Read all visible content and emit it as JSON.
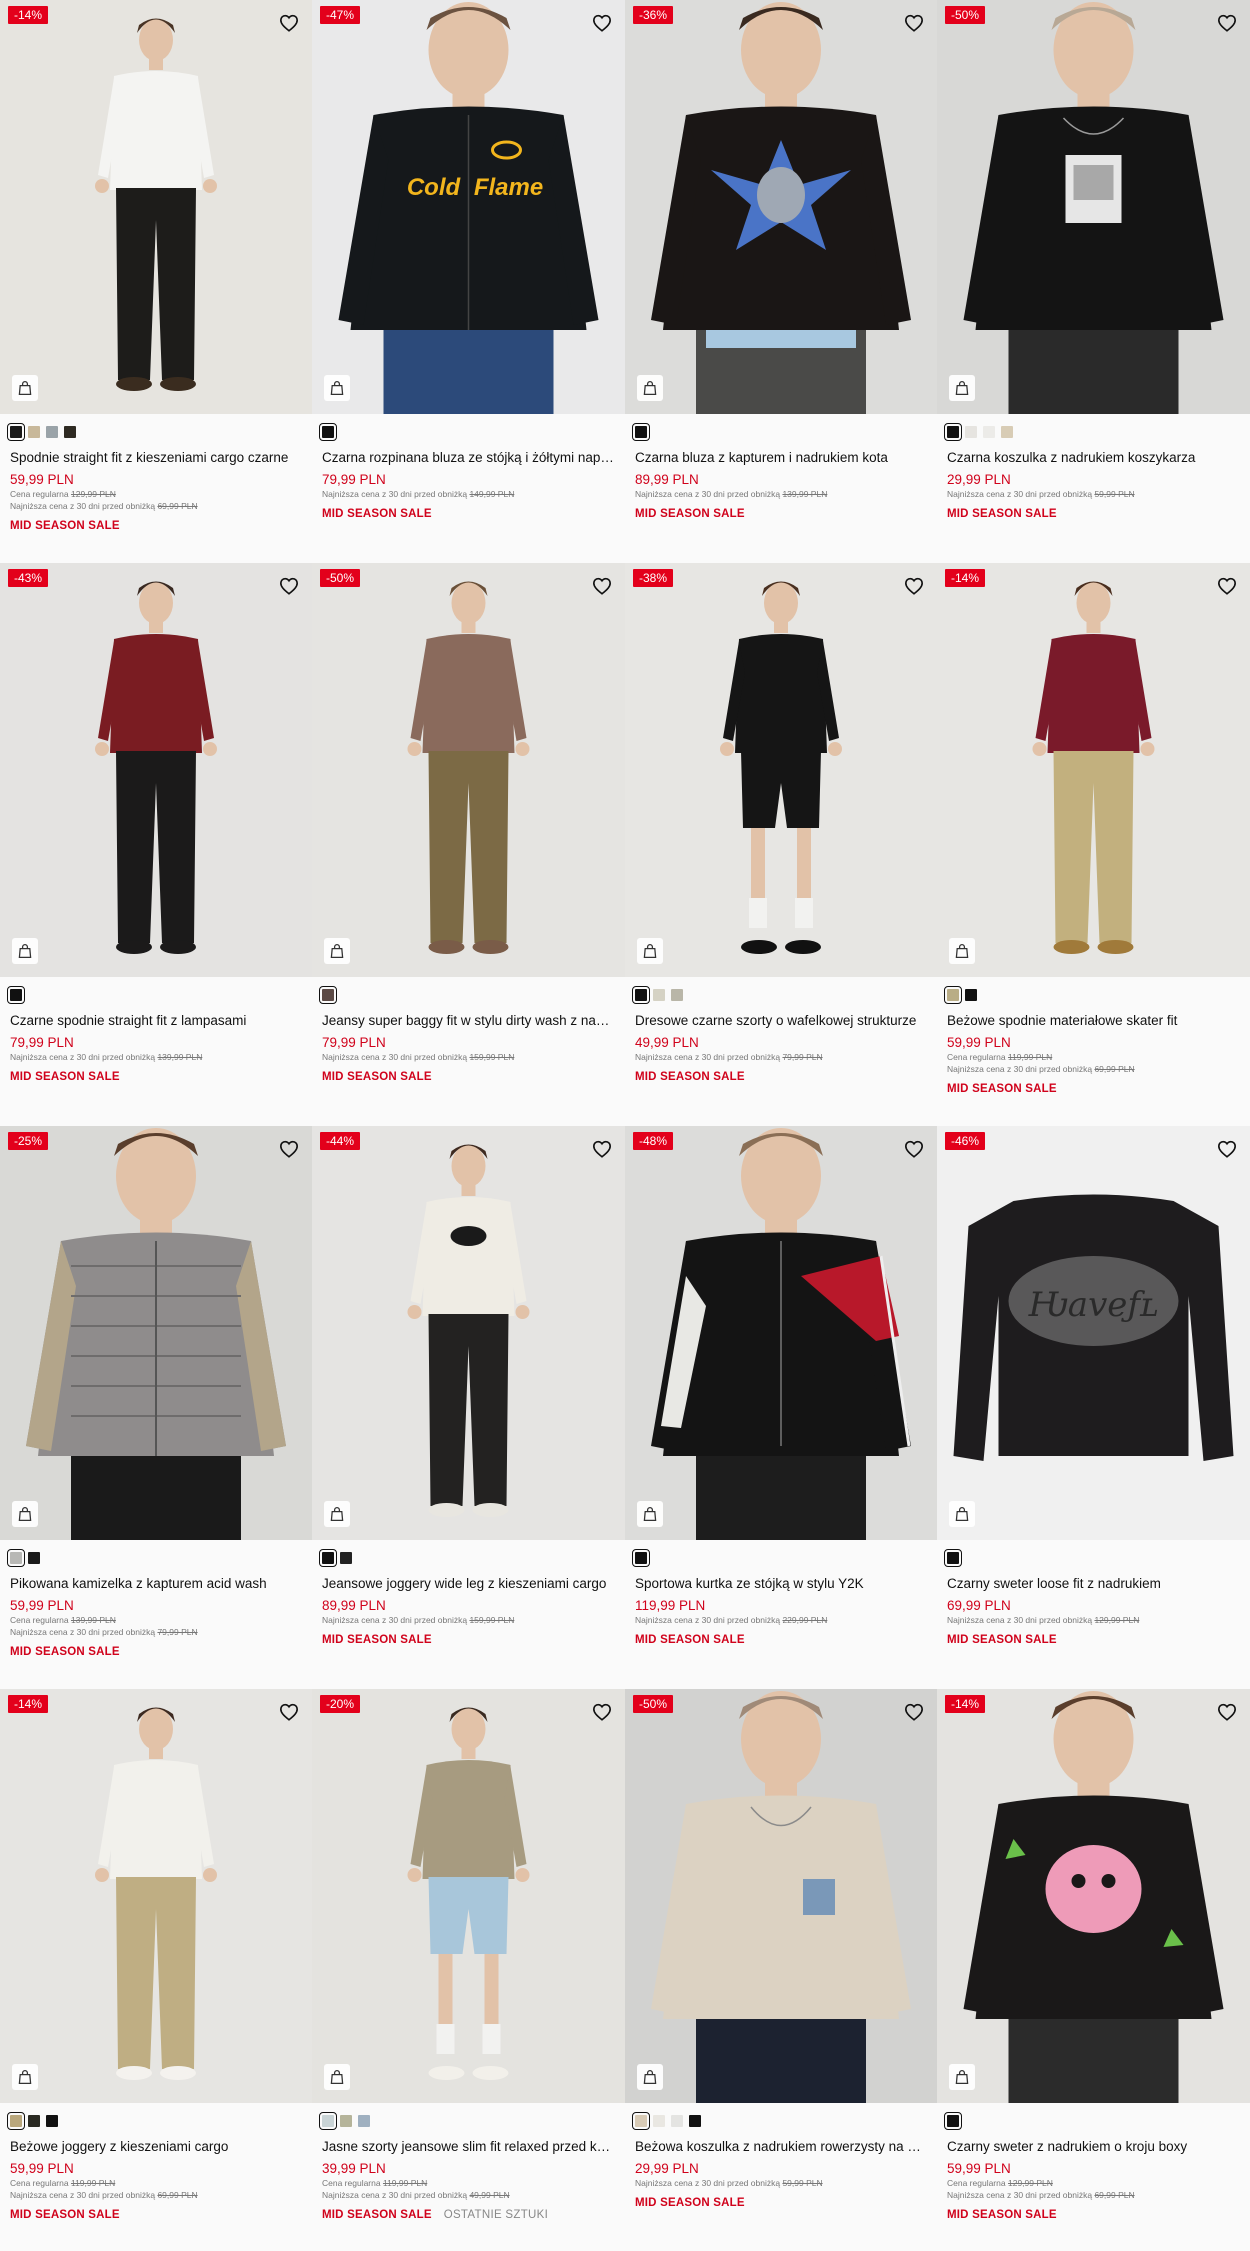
{
  "labels": {
    "regular": "Cena regularna",
    "lowest": "Najniższa cena z 30 dni przed obniżką",
    "currency": "PLN"
  },
  "products": [
    {
      "badge": "-14%",
      "name": "Spodnie straight fit z kieszeniami cargo czarne",
      "price": "59,99 PLN",
      "regular": "129,99 PLN",
      "lowest": "69,99 PLN",
      "sale": "MID SEASON SALE",
      "swatches": [
        "#1a1a1a",
        "#c8b89a",
        "#9aa3a8",
        "#2e2a22"
      ],
      "bg": "#e6e4df",
      "top": "#f4f4f2",
      "bottom": "#1d1c1a",
      "shoes": "#3a2c1f",
      "hair": "#4a3425",
      "pose": "standing",
      "print": ""
    },
    {
      "badge": "-47%",
      "name": "Czarna rozpinana bluza ze stójką i żółtymi napisami",
      "price": "79,99 PLN",
      "lowest": "149,99 PLN",
      "sale": "MID SEASON SALE",
      "swatches": [
        "#111111"
      ],
      "bg": "#e9e9ea",
      "top": "#15181b",
      "bottom": "#2c4a7a",
      "shoes": "#2c4a7a",
      "hair": "#6b5240",
      "pose": "close",
      "print": "yellow"
    },
    {
      "badge": "-36%",
      "name": "Czarna bluza z kapturem i nadrukiem kota",
      "price": "89,99 PLN",
      "lowest": "139,99 PLN",
      "sale": "MID SEASON SALE",
      "swatches": [
        "#111111"
      ],
      "bg": "#dcdcda",
      "top": "#1a1615",
      "bottom": "#4a4a48",
      "shoes": "#4a4a48",
      "hair": "#3a2a20",
      "pose": "close",
      "print": "star"
    },
    {
      "badge": "-50%",
      "name": "Czarna koszulka z nadrukiem koszykarza",
      "price": "29,99 PLN",
      "lowest": "59,99 PLN",
      "sale": "MID SEASON SALE",
      "swatches": [
        "#111111",
        "#e6e4e0",
        "#ecebe8",
        "#d8ccb5"
      ],
      "bg": "#d8d8d6",
      "top": "#141414",
      "bottom": "#2a2a2a",
      "shoes": "#2a2a2a",
      "hair": "#b8a895",
      "pose": "close",
      "print": "photo"
    },
    {
      "badge": "-43%",
      "name": "Czarne spodnie straight fit z lampasami",
      "price": "79,99 PLN",
      "lowest": "139,99 PLN",
      "sale": "MID SEASON SALE",
      "swatches": [
        "#111111"
      ],
      "bg": "#e4e3e1",
      "top": "#7a1c22",
      "bottom": "#1b1a1a",
      "shoes": "#1b1a1a",
      "hair": "#3a2a22",
      "pose": "standing",
      "print": ""
    },
    {
      "badge": "-50%",
      "name": "Jeansy super baggy fit w stylu dirty wash z nadrukiem",
      "price": "79,99 PLN",
      "lowest": "159,99 PLN",
      "sale": "MID SEASON SALE",
      "swatches": [
        "#5c4a45"
      ],
      "bg": "#e5e4e1",
      "top": "#8a6a5c",
      "bottom": "#7c6a45",
      "shoes": "#7a5c48",
      "hair": "#6a5038",
      "pose": "standing",
      "print": ""
    },
    {
      "badge": "-38%",
      "name": "Dresowe czarne szorty o wafelkowej strukturze",
      "price": "49,99 PLN",
      "lowest": "79,99 PLN",
      "sale": "MID SEASON SALE",
      "swatches": [
        "#111111",
        "#d5d2c4",
        "#b9b6a8"
      ],
      "bg": "#e7e6e3",
      "top": "#151515",
      "bottom": "#151515",
      "shoes": "#111111",
      "hair": "#4a3020",
      "pose": "shorts",
      "print": ""
    },
    {
      "badge": "-14%",
      "name": "Beżowe spodnie materiałowe skater fit",
      "price": "59,99 PLN",
      "regular": "119,99 PLN",
      "lowest": "69,99 PLN",
      "sale": "MID SEASON SALE",
      "swatches": [
        "#b9ad86",
        "#111111"
      ],
      "bg": "#e7e6e3",
      "top": "#7a1a2a",
      "bottom": "#c2b07e",
      "shoes": "#a07a3a",
      "hair": "#4a2e1e",
      "pose": "standing",
      "print": ""
    },
    {
      "badge": "-25%",
      "name": "Pikowana kamizelka z kapturem acid wash",
      "price": "59,99 PLN",
      "regular": "139,99 PLN",
      "lowest": "79,99 PLN",
      "sale": "MID SEASON SALE",
      "swatches": [
        "#b8b8b5",
        "#1a1a1a"
      ],
      "bg": "#d9d9d6",
      "top": "#8f8c8c",
      "bottom": "#1a1a1a",
      "shoes": "#1a1a1a",
      "hair": "#5a3e2c",
      "pose": "close",
      "print": "vest"
    },
    {
      "badge": "-44%",
      "name": "Jeansowe joggery wide leg z kieszeniami cargo",
      "price": "89,99 PLN",
      "lowest": "159,99 PLN",
      "sale": "MID SEASON SALE",
      "swatches": [
        "#111111",
        "#222222"
      ],
      "bg": "#e5e4e2",
      "top": "#efece4",
      "bottom": "#232221",
      "shoes": "#e8e6e0",
      "hair": "#3e2a20",
      "pose": "standing",
      "print": "lips"
    },
    {
      "badge": "-48%",
      "name": "Sportowa kurtka ze stójką w stylu Y2K",
      "price": "119,99 PLN",
      "lowest": "229,99 PLN",
      "sale": "MID SEASON SALE",
      "swatches": [
        "#111111"
      ],
      "bg": "#dcdcda",
      "top": "#141414",
      "bottom": "#1d1d1d",
      "shoes": "#1d1d1d",
      "hair": "#8a6e55",
      "pose": "close",
      "print": "redstripe"
    },
    {
      "badge": "-46%",
      "name": "Czarny sweter loose fit z nadrukiem",
      "price": "69,99 PLN",
      "lowest": "129,99 PLN",
      "sale": "MID SEASON SALE",
      "swatches": [
        "#111111"
      ],
      "bg": "#f0f0f0",
      "top": "#1e1c1e",
      "bottom": "#f0f0f0",
      "shoes": "#f0f0f0",
      "hair": "#f0f0f0",
      "pose": "flat",
      "print": "gothic"
    },
    {
      "badge": "-14%",
      "name": "Beżowe joggery z kieszeniami cargo",
      "price": "59,99 PLN",
      "regular": "119,99 PLN",
      "lowest": "69,99 PLN",
      "sale": "MID SEASON SALE",
      "swatches": [
        "#b9a77c",
        "#2a2a22",
        "#111111"
      ],
      "bg": "#e6e5e2",
      "top": "#f2f1ec",
      "bottom": "#bfae83",
      "shoes": "#f4f2ee",
      "hair": "#3e2a20",
      "pose": "standing",
      "print": ""
    },
    {
      "badge": "-20%",
      "name": "Jasne szorty jeansowe slim fit relaxed przed kolano",
      "price": "39,99 PLN",
      "regular": "119,99 PLN",
      "lowest": "49,99 PLN",
      "sale": "MID SEASON SALE",
      "last": "OSTATNIE SZTUKI",
      "swatches": [
        "#c9d4d6",
        "#b5b49a",
        "#9fb0c0"
      ],
      "bg": "#e4e3df",
      "top": "#a79b80",
      "bottom": "#a8c6da",
      "shoes": "#f2f0ea",
      "hair": "#3a2a20",
      "pose": "shorts",
      "print": ""
    },
    {
      "badge": "-50%",
      "name": "Beżowa koszulka z nadrukiem rowerzysty na kieszeni",
      "price": "29,99 PLN",
      "lowest": "59,99 PLN",
      "sale": "MID SEASON SALE",
      "swatches": [
        "#d8cbb6",
        "#e9e7e2",
        "#e4e4e2",
        "#111111"
      ],
      "bg": "#d2d2d0",
      "top": "#dcd2c2",
      "bottom": "#1c2230",
      "shoes": "#1c2230",
      "hair": "#a08a78",
      "pose": "close",
      "print": "pocket"
    },
    {
      "badge": "-14%",
      "name": "Czarny sweter z nadrukiem o kroju boxy",
      "price": "59,99 PLN",
      "regular": "129,99 PLN",
      "lowest": "69,99 PLN",
      "sale": "MID SEASON SALE",
      "swatches": [
        "#111111"
      ],
      "bg": "#e4e3e0",
      "top": "#1a1818",
      "bottom": "#2b2b2b",
      "shoes": "#2b2b2b",
      "hair": "#5a3e2c",
      "pose": "close",
      "print": "pink"
    }
  ]
}
